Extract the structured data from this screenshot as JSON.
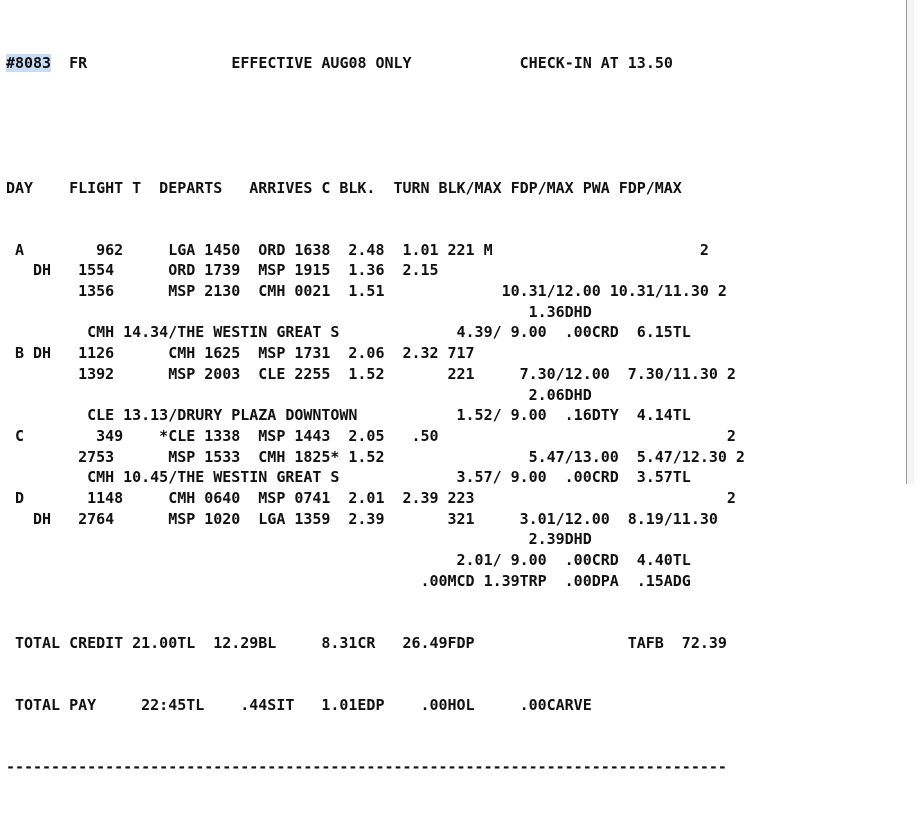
{
  "header": {
    "trip_number": "#8083",
    "day_code": "FR",
    "effective": "EFFECTIVE AUG08 ONLY",
    "check_in": "CHECK-IN AT 13.50"
  },
  "columns": "DAY    FLIGHT T  DEPARTS   ARRIVES C BLK.  TURN BLK/MAX FDP/MAX PWA FDP/MAX",
  "lines": [
    " A        962     LGA 1450  ORD 1638  2.48  1.01 221 M                       2",
    "   DH   1554      ORD 1739  MSP 1915  1.36  2.15",
    "        1356      MSP 2130  CMH 0021  1.51             10.31/12.00 10.31/11.30 2",
    "                                                          1.36DHD",
    "         CMH 14.34/THE WESTIN GREAT S             4.39/ 9.00  .00CRD  6.15TL",
    " B DH   1126      CMH 1625  MSP 1731  2.06  2.32 717",
    "        1392      MSP 2003  CLE 2255  1.52       221     7.30/12.00  7.30/11.30 2",
    "                                                          2.06DHD",
    "         CLE 13.13/DRURY PLAZA DOWNTOWN           1.52/ 9.00  .16DTY  4.14TL",
    " C        349    *CLE 1338  MSP 1443  2.05   .50                                2",
    "        2753      MSP 1533  CMH 1825* 1.52                5.47/13.00  5.47/12.30 2",
    "         CMH 10.45/THE WESTIN GREAT S             3.57/ 9.00  .00CRD  3.57TL",
    " D       1148     CMH 0640  MSP 0741  2.01  2.39 223                            2",
    "   DH   2764      MSP 1020  LGA 1359  2.39       321     3.01/12.00  8.19/11.30",
    "                                                          2.39DHD",
    "                                                  2.01/ 9.00  .00CRD  4.40TL",
    "                                              .00MCD 1.39TRP  .00DPA  .15ADG"
  ],
  "totals": {
    "credit": " TOTAL CREDIT 21.00TL  12.29BL     8.31CR   26.49FDP                 TAFB  72.39",
    "pay": " TOTAL PAY     22:45TL    .44SIT   1.01EDP    .00HOL     .00CARVE"
  },
  "divider": "--------------------------------------------------------------------------------"
}
